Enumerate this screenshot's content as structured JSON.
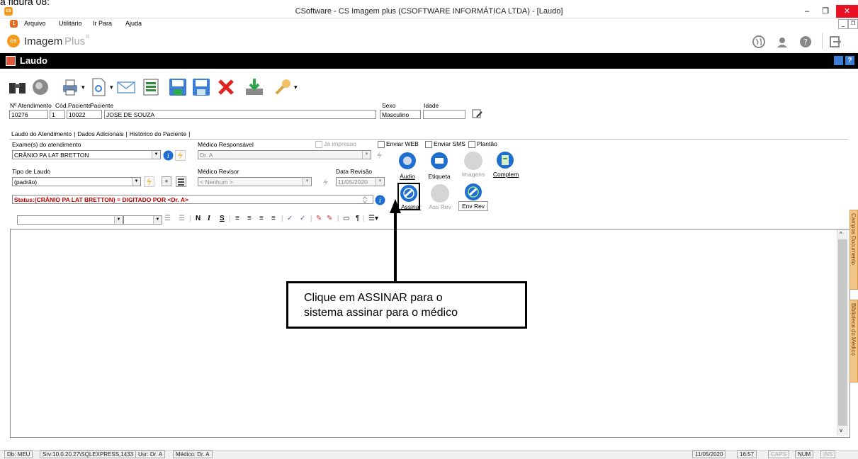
{
  "caption": "a figura 08:",
  "window": {
    "title": "CSoftware - CS Imagem plus (CSOFTWARE INFORMÁTICA LTDA) - [Laudo]"
  },
  "menu": {
    "items": [
      "Arquivo",
      "Utilitário",
      "Ir Para",
      "Ajuda"
    ]
  },
  "brand": {
    "name": "Imagem",
    "name2": "Plus",
    "reg": "®"
  },
  "form_title": "Laudo",
  "patient": {
    "atendimento_label": "Nº Atendimento",
    "atendimento_value": "10276",
    "seq_value": "1",
    "cod_label": "Cód.Paciente",
    "cod_value": "10022",
    "paciente_label": "Paciente",
    "paciente_value": "JOSE DE SOUZA",
    "sexo_label": "Sexo",
    "sexo_value": "Masculino",
    "idade_label": "Idade",
    "idade_value": ""
  },
  "tabs": [
    "Laudo do Atendimento",
    "Dados Adicionais",
    "Histórico do Paciente"
  ],
  "laudo": {
    "exames_label": "Exame(s) do atendimento",
    "exame_value": "CRÂNIO PA LAT BRETTON",
    "medico_label": "Médico Responsável",
    "medico_value": "Dr. A",
    "ja_impresso": "Já impresso",
    "enviar_web": "Enviar WEB",
    "enviar_sms": "Enviar SMS",
    "plantao": "Plantão",
    "tipo_label": "Tipo de Laudo",
    "tipo_value": "(padrão)",
    "revisor_label": "Médico Revisor",
    "revisor_value": "< Nenhum >",
    "data_revisao_label": "Data Revisão",
    "data_revisao_value": "11/05/2020",
    "status_text": "Status:(CRÂNIO PA LAT BRETTON) = DIGITADO POR <Dr. A>"
  },
  "action_buttons": {
    "audio": "Áudio",
    "etiqueta": "Etiqueta",
    "imagens": "Imagens",
    "complem": "Complem",
    "assinar": "Assinar",
    "ass_rev": "Ass Rev",
    "env_rev": "Env Rev"
  },
  "format_toolbar": {
    "bold": "N",
    "italic": "I",
    "underline": "S"
  },
  "callout": {
    "line1": "Clique em ASSINAR para o",
    "line2": "sistema assinar para o médico"
  },
  "side_tabs": [
    "Campos Documento",
    "Biblioteca do Médico"
  ],
  "statusbar": {
    "db": "Db: MEU",
    "srv": "Srv:10.0.20.27\\SQLEXPRESS,1433",
    "usr": "Usr: Dr. A",
    "medico": "Médico: Dr. A",
    "date": "11/05/2020",
    "time": "16:57",
    "caps": "CAPS",
    "num": "NUM",
    "ins": "INS"
  },
  "colors": {
    "status_red": "#c00000",
    "brand_orange": "#f39a1c",
    "blue_icon": "#1f6fd0",
    "close_red": "#e81123"
  }
}
